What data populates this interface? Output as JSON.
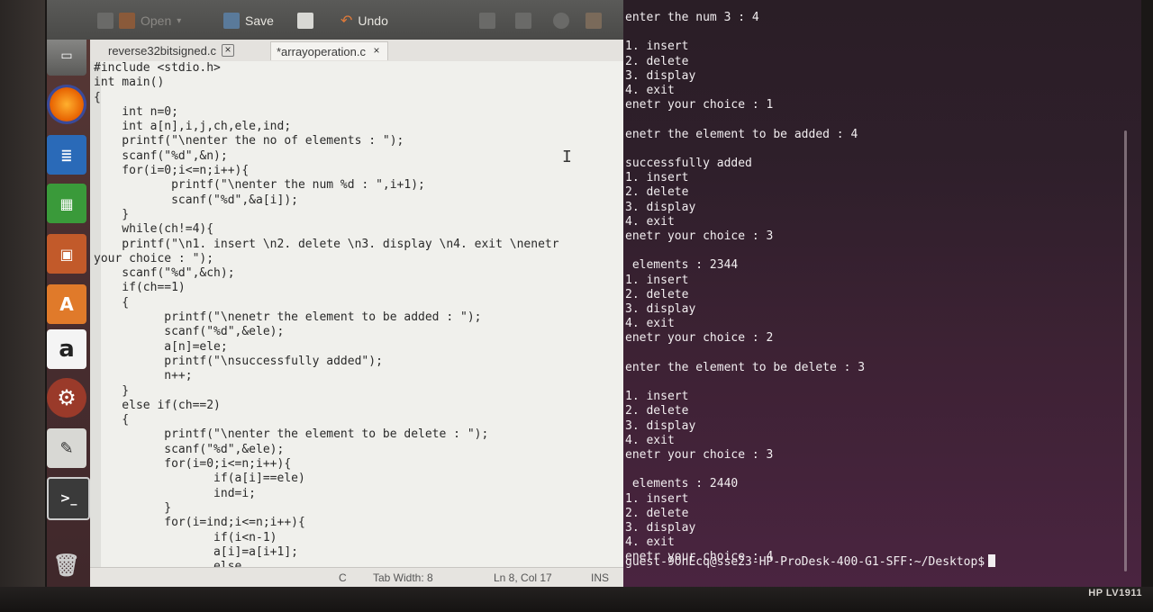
{
  "toolbar": {
    "open_label": "Open",
    "save_label": "Save",
    "undo_label": "Undo"
  },
  "tabs": [
    {
      "label": "reverse32bitsigned.c",
      "close": "×"
    },
    {
      "label": "*arrayoperation.c",
      "close": "×"
    }
  ],
  "editor": {
    "code": "#include <stdio.h>\nint main()\n{\n    int n=0;\n    int a[n],i,j,ch,ele,ind;\n    printf(\"\\nenter the no of elements : \");\n    scanf(\"%d\",&n);\n    for(i=0;i<=n;i++){\n           printf(\"\\nenter the num %d : \",i+1);\n           scanf(\"%d\",&a[i]);\n    }\n    while(ch!=4){\n    printf(\"\\n1. insert \\n2. delete \\n3. display \\n4. exit \\nenetr\nyour choice : \");\n    scanf(\"%d\",&ch);\n    if(ch==1)\n    {\n          printf(\"\\nenetr the element to be added : \");\n          scanf(\"%d\",&ele);\n          a[n]=ele;\n          printf(\"\\nsuccessfully added\");\n          n++;\n    }\n    else if(ch==2)\n    {\n          printf(\"\\nenter the element to be delete : \");\n          scanf(\"%d\",&ele);\n          for(i=0;i<=n;i++){\n                 if(a[i]==ele)\n                 ind=i;\n          }\n          for(i=ind;i<=n;i++){\n                 if(i<n-1)\n                 a[i]=a[i+1];\n                 else"
  },
  "statusbar": {
    "language": "C",
    "tab_width": "Tab Width: 8",
    "position": "Ln 8, Col 17",
    "mode": "INS"
  },
  "terminal": {
    "lines": [
      "enter the num 3 : 4",
      "",
      "1. insert",
      "2. delete",
      "3. display",
      "4. exit",
      "enetr your choice : 1",
      "",
      "enetr the element to be added : 4",
      "",
      "successfully added",
      "1. insert",
      "2. delete",
      "3. display",
      "4. exit",
      "enetr your choice : 3",
      "",
      " elements : 2344",
      "1. insert",
      "2. delete",
      "3. display",
      "4. exit",
      "enetr your choice : 2",
      "",
      "enter the element to be delete : 3",
      "",
      "1. insert",
      "2. delete",
      "3. display",
      "4. exit",
      "enetr your choice : 3",
      "",
      " elements : 2440",
      "1. insert",
      "2. delete",
      "3. display",
      "4. exit",
      "enetr your choice : 4"
    ],
    "prompt": "guest-9OnEcq@sse23-HP-ProDesk-400-G1-SFF:~/Desktop$"
  },
  "monitor": {
    "brand": "HP LV1911"
  },
  "launcher": {
    "icons": [
      "dash-icon",
      "files-icon",
      "firefox-icon",
      "writer-icon",
      "calc-icon",
      "impress-icon",
      "software-center-icon",
      "amazon-icon",
      "settings-icon",
      "text-editor-icon",
      "terminal-icon",
      "trash-icon"
    ]
  }
}
